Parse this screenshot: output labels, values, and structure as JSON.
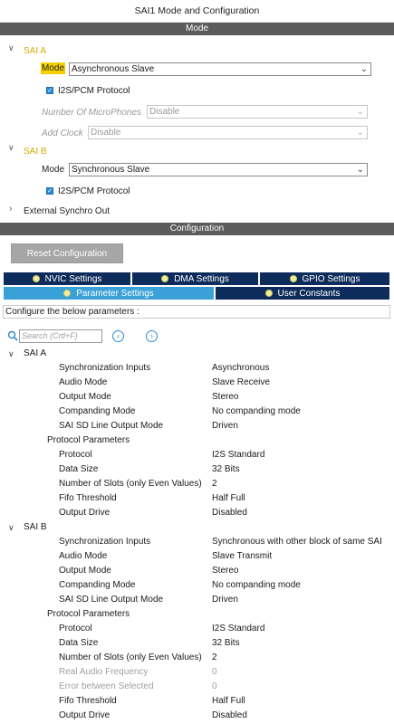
{
  "window": {
    "title": "SAI1 Mode and Configuration"
  },
  "mode_section": {
    "header": "Mode",
    "sai_a": {
      "label": "SAI A",
      "mode_label": "Mode",
      "mode_value": "Asynchronous Slave",
      "protocol_checkbox": "I2S/PCM Protocol",
      "microphones_label": "Number Of MicroPhones",
      "microphones_value": "Disable",
      "add_clock_label": "Add Clock",
      "add_clock_value": "Disable"
    },
    "sai_b": {
      "label": "SAI B",
      "mode_label": "Mode",
      "mode_value": "Synchronous Slave",
      "protocol_checkbox": "I2S/PCM Protocol"
    },
    "external_synchro": "External Synchro Out"
  },
  "config_section": {
    "header": "Configuration",
    "reset_button": "Reset Configuration",
    "tabs_row1": [
      "NVIC Settings",
      "DMA Settings",
      "GPIO Settings"
    ],
    "tabs_row2": [
      "Parameter Settings",
      "User Constants"
    ],
    "caption": "Configure the below parameters :",
    "search_placeholder": "Search (Crtl+F)",
    "icons": {
      "search": "search-icon",
      "prev": "arrow-left-circle-icon",
      "next": "arrow-right-circle-icon"
    }
  },
  "tree": {
    "sai_a": {
      "label": "SAI A",
      "params": [
        {
          "name": "Synchronization Inputs",
          "value": "Asynchronous"
        },
        {
          "name": "Audio Mode",
          "value": "Slave Receive"
        },
        {
          "name": "Output Mode",
          "value": "Stereo"
        },
        {
          "name": "Companding Mode",
          "value": "No companding mode"
        },
        {
          "name": "SAI SD Line Output Mode",
          "value": "Driven"
        }
      ],
      "protocol_group": "Protocol Parameters",
      "protocol": [
        {
          "name": "Protocol",
          "value": "I2S Standard"
        },
        {
          "name": "Data Size",
          "value": "32 Bits"
        },
        {
          "name": "Number of Slots (only Even Values)",
          "value": "2"
        },
        {
          "name": "Fifo Threshold",
          "value": "Half Full"
        },
        {
          "name": "Output Drive",
          "value": "Disabled"
        }
      ]
    },
    "sai_b": {
      "label": "SAI B",
      "params": [
        {
          "name": "Synchronization Inputs",
          "value": "Synchronous with other block of same SAI"
        },
        {
          "name": "Audio Mode",
          "value": "Slave Transmit"
        },
        {
          "name": "Output Mode",
          "value": "Stereo"
        },
        {
          "name": "Companding Mode",
          "value": "No companding mode"
        },
        {
          "name": "SAI SD Line Output Mode",
          "value": "Driven"
        }
      ],
      "protocol_group": "Protocol Parameters",
      "protocol": [
        {
          "name": "Protocol",
          "value": "I2S Standard"
        },
        {
          "name": "Data Size",
          "value": "32 Bits"
        },
        {
          "name": "Number of Slots (only Even Values)",
          "value": "2"
        },
        {
          "name": "Real Audio Frequency",
          "value": "0"
        },
        {
          "name": "Error between Selected",
          "value": "0"
        },
        {
          "name": "Fifo Threshold",
          "value": "Half Full"
        },
        {
          "name": "Output Drive",
          "value": "Disabled"
        }
      ]
    }
  },
  "colors": {
    "accent": "#3aa0d8",
    "tab_dark": "#0e2c5b",
    "sai_label": "#d4ab00",
    "highlight": "#f5d000",
    "section_bar": "#5b5b5b"
  }
}
